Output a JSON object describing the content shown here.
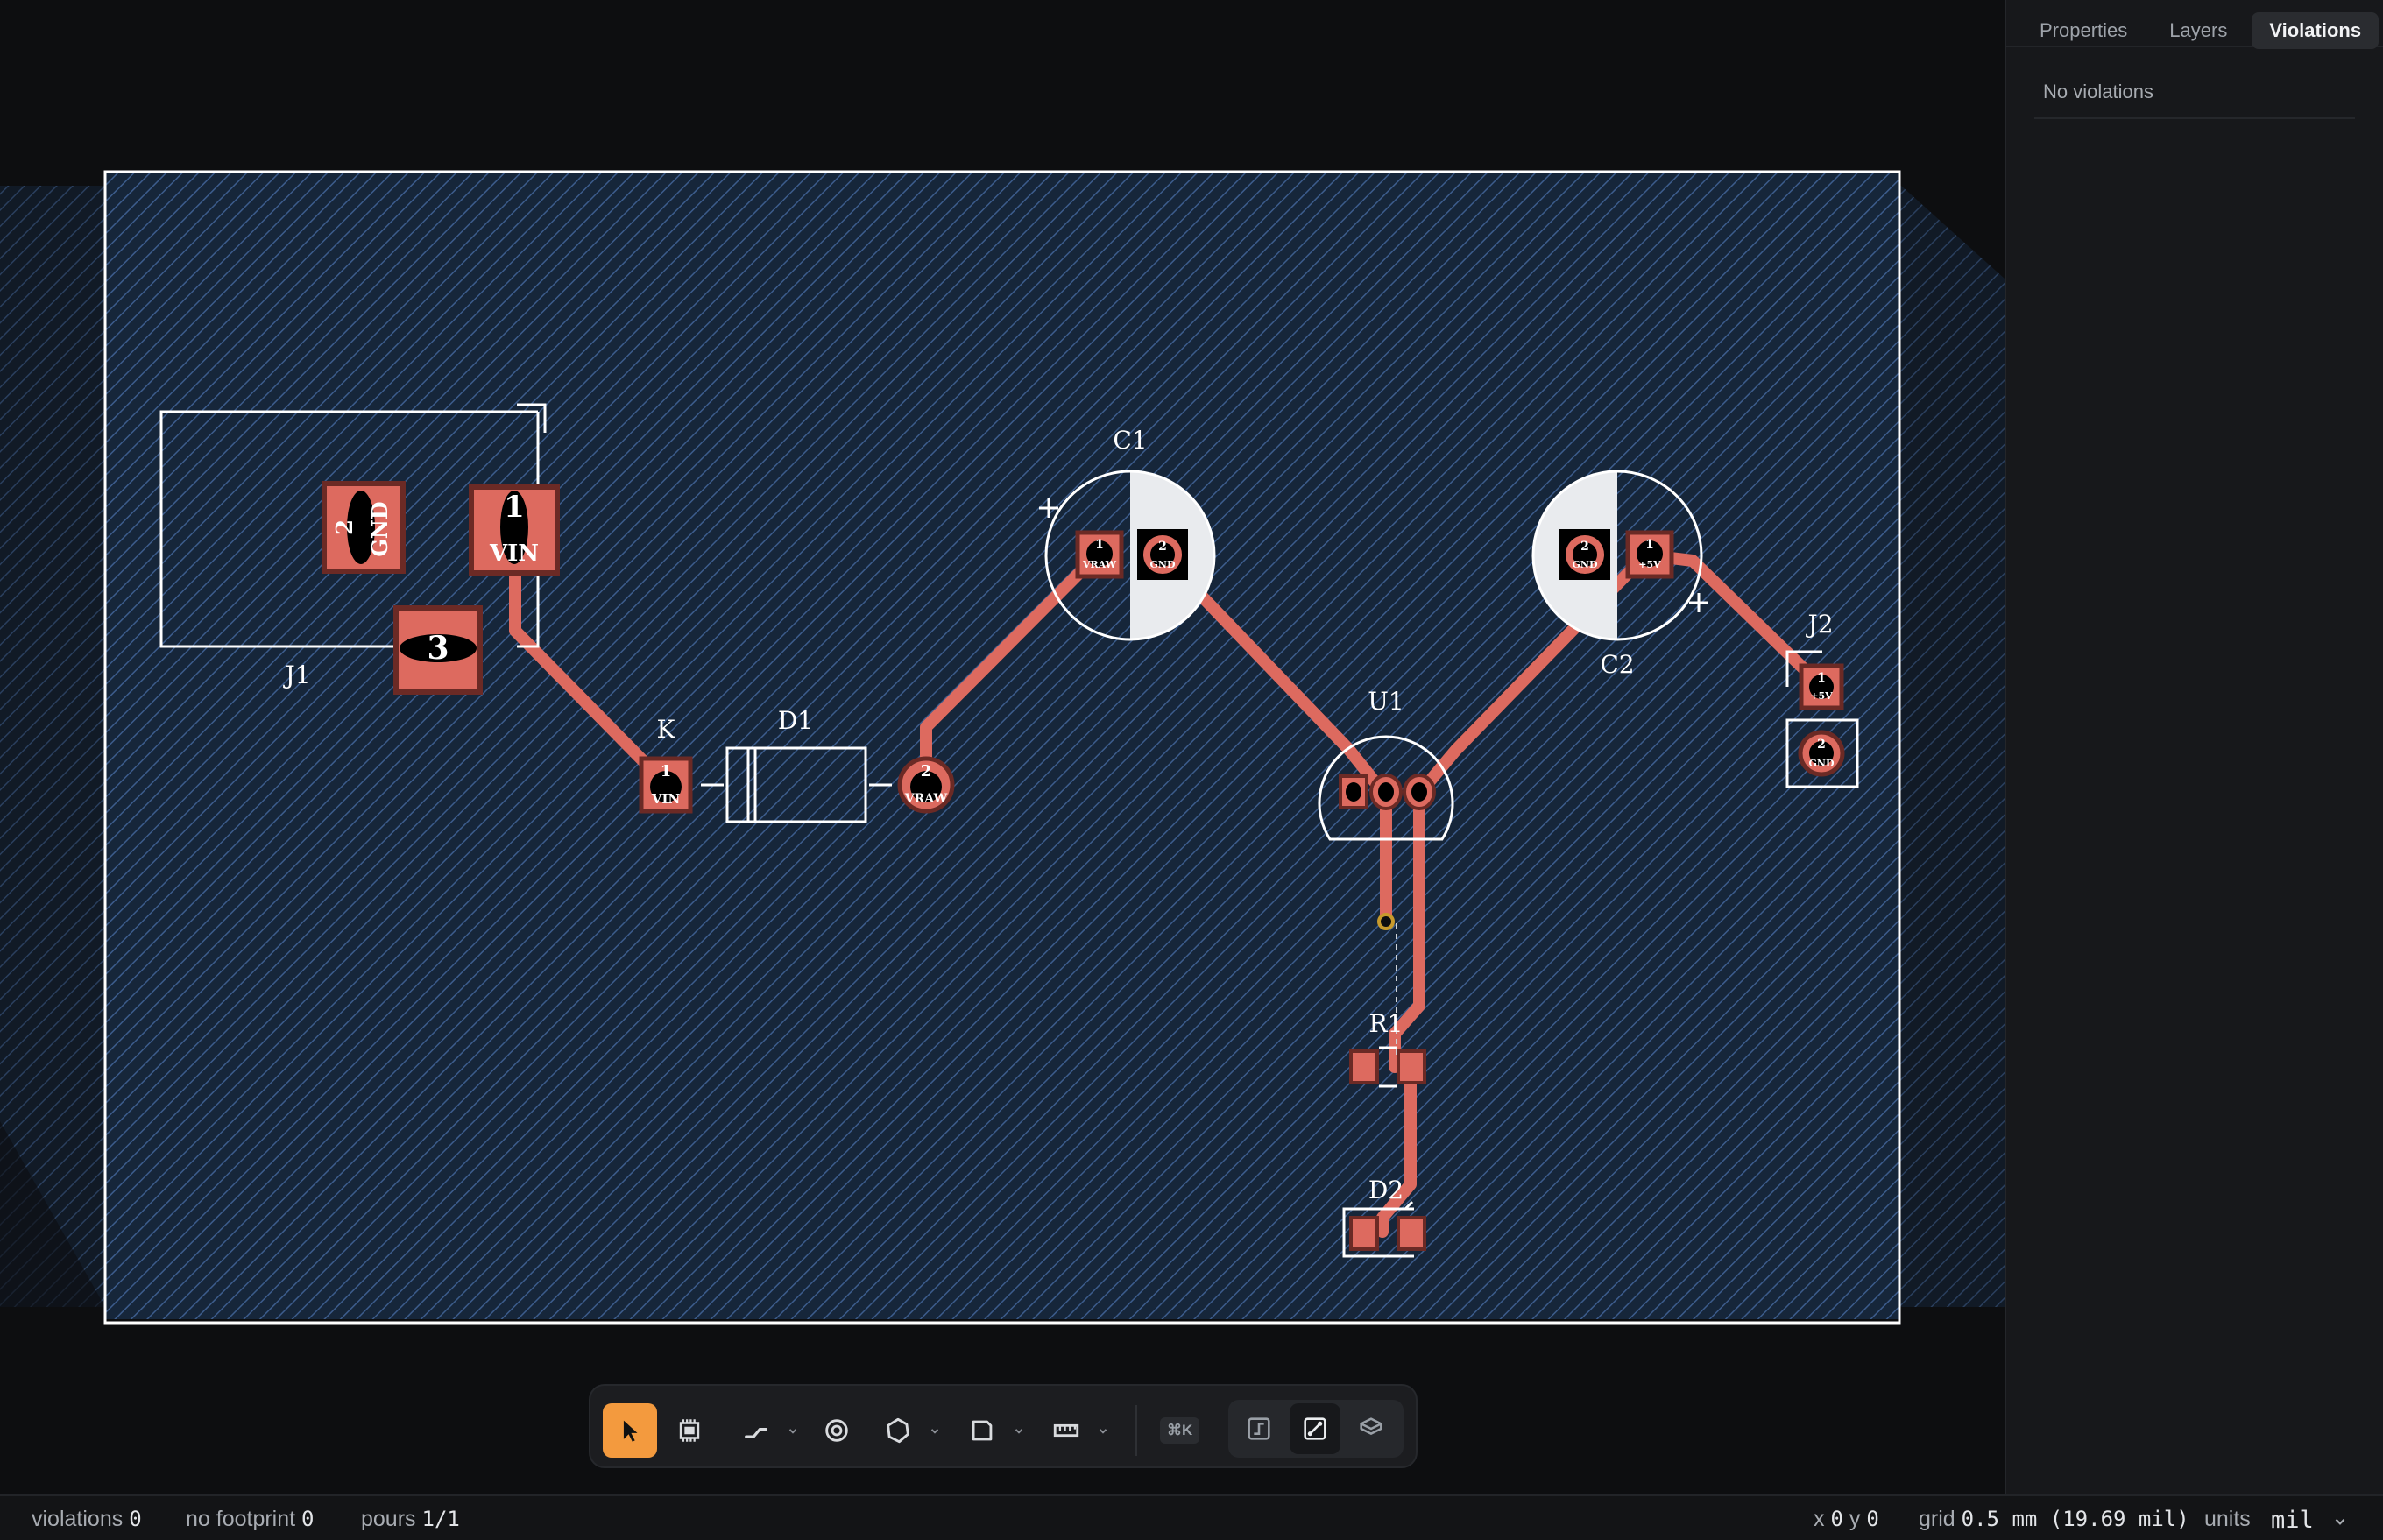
{
  "panel": {
    "tabs": [
      {
        "label": "Properties",
        "active": false
      },
      {
        "label": "Layers",
        "active": false
      },
      {
        "label": "Violations",
        "active": true
      }
    ],
    "violations_message": "No violations"
  },
  "board": {
    "components": {
      "j1": {
        "ref": "J1",
        "pins": [
          "1",
          "2",
          "3"
        ],
        "nets": {
          "1": "VIN",
          "2": "GND"
        }
      },
      "k": {
        "ref": "K",
        "pin": "1",
        "net": "VIN"
      },
      "d1": {
        "ref": "D1",
        "pin": "2",
        "net": "VRAW"
      },
      "c1": {
        "ref": "C1",
        "pins": [
          {
            "num": "1",
            "net": "VRAW"
          },
          {
            "num": "2",
            "net": "GND"
          }
        ]
      },
      "c2": {
        "ref": "C2",
        "pins": [
          {
            "num": "2",
            "net": "GND"
          },
          {
            "num": "1",
            "net": "+5V"
          }
        ]
      },
      "u1": {
        "ref": "U1"
      },
      "r1": {
        "ref": "R1"
      },
      "d2": {
        "ref": "D2"
      },
      "j2": {
        "ref": "J2",
        "pins": [
          {
            "num": "1",
            "net": "+5V"
          },
          {
            "num": "2",
            "net": "GND"
          }
        ]
      }
    },
    "colors": {
      "copper": "#dd6a5f",
      "pour": "#3c5c8c",
      "board_bg": "#16263a",
      "silkscreen": "#ffffff",
      "via": "#c79a2c",
      "accent": "#f39a3e"
    }
  },
  "toolbar": {
    "cmdk_label": "⌘K",
    "tools": [
      {
        "name": "select-tool",
        "icon": "cursor-icon",
        "active": true
      },
      {
        "name": "footprint-tool",
        "icon": "chip-icon"
      },
      {
        "name": "route-tool",
        "icon": "route-icon"
      },
      {
        "name": "via-tool",
        "icon": "via-icon"
      },
      {
        "name": "pour-tool",
        "icon": "polygon-icon"
      },
      {
        "name": "board-outline-tool",
        "icon": "outline-icon"
      },
      {
        "name": "measure-tool",
        "icon": "ruler-icon"
      }
    ],
    "view_modes": [
      {
        "name": "schematic-view",
        "icon": "schematic-icon"
      },
      {
        "name": "pcb-view",
        "icon": "pcb-icon",
        "selected": true
      },
      {
        "name": "3d-view",
        "icon": "cube-icon"
      }
    ]
  },
  "status": {
    "violations_label": "violations",
    "violations_count": "0",
    "no_footprint_label": "no footprint",
    "no_footprint_count": "0",
    "pours_label": "pours",
    "pours_count": "1/1",
    "x_label": "x",
    "x_value": "0",
    "y_label": "y",
    "y_value": "0",
    "grid_label": "grid",
    "grid_value": "0.5 mm (19.69 mil)",
    "units_label": "units",
    "units_value": "mil"
  }
}
